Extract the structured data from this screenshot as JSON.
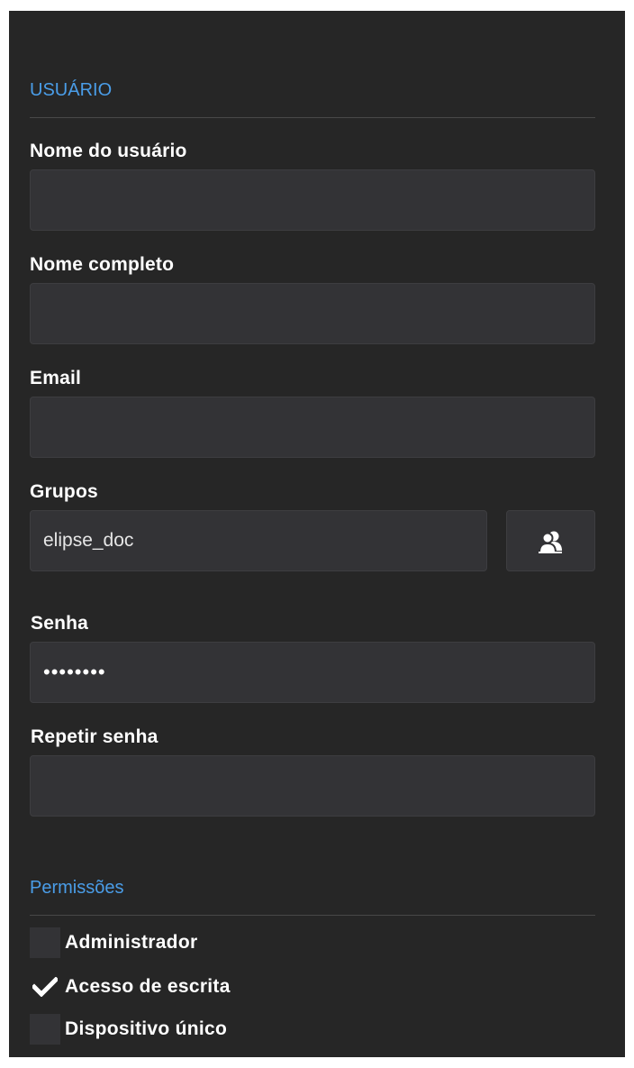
{
  "user_section": {
    "title": "USUÁRIO"
  },
  "fields": {
    "username": {
      "label": "Nome do usuário",
      "value": ""
    },
    "full_name": {
      "label": "Nome completo",
      "value": ""
    },
    "email": {
      "label": "Email",
      "value": ""
    },
    "groups": {
      "label": "Grupos",
      "value": "elipse_doc",
      "button_icon": "user-group-icon"
    },
    "password": {
      "label": "Senha",
      "value": "••••••••"
    },
    "repeat_password": {
      "label": "Repetir senha",
      "value": ""
    }
  },
  "permissions": {
    "title": "Permissões",
    "items": [
      {
        "label": "Administrador",
        "checked": false
      },
      {
        "label": "Acesso de escrita",
        "checked": true
      },
      {
        "label": "Dispositivo único",
        "checked": false
      }
    ]
  },
  "colors": {
    "background": "#262626",
    "accent": "#4a9de8",
    "input_background": "#333336"
  }
}
